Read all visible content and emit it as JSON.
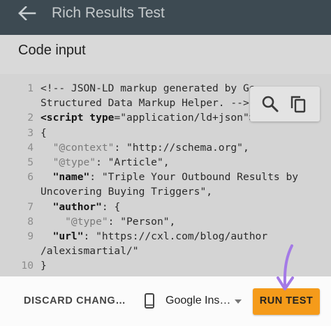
{
  "appbar": {
    "title": "Rich Results Test"
  },
  "panel": {
    "title": "Code input"
  },
  "code_lines": [
    {
      "num": "1",
      "tokens": [
        {
          "t": "<!-- JSON-LD markup generated by Go…",
          "c": "s-str"
        }
      ]
    },
    {
      "num": "",
      "tokens": [
        {
          "t": "Structured Data Markup Helper. -->",
          "c": "s-str"
        }
      ]
    },
    {
      "num": "2",
      "tokens": [
        {
          "t": "<script ",
          "c": "s-bold"
        },
        {
          "t": "type",
          "c": "s-bold"
        },
        {
          "t": "=\"application/ld+json\">",
          "c": "s-str"
        }
      ]
    },
    {
      "num": "3",
      "tokens": [
        {
          "t": "{",
          "c": "s-str"
        }
      ]
    },
    {
      "num": "4",
      "tokens": [
        {
          "t": "  \"@context\"",
          "c": "s-key"
        },
        {
          "t": ": \"http://schema.org\",",
          "c": "s-str"
        }
      ]
    },
    {
      "num": "5",
      "tokens": [
        {
          "t": "  \"@type\"",
          "c": "s-key"
        },
        {
          "t": ": \"Article\",",
          "c": "s-str"
        }
      ]
    },
    {
      "num": "6",
      "tokens": [
        {
          "t": "  \"name\"",
          "c": "s-bold"
        },
        {
          "t": ": \"Triple Your Outbound Results by",
          "c": "s-str"
        }
      ]
    },
    {
      "num": "",
      "tokens": [
        {
          "t": "Uncovering Buying Triggers\",",
          "c": "s-str"
        }
      ]
    },
    {
      "num": "7",
      "tokens": [
        {
          "t": "  \"author\"",
          "c": "s-bold"
        },
        {
          "t": ": {",
          "c": "s-str"
        }
      ]
    },
    {
      "num": "8",
      "tokens": [
        {
          "t": "    \"@type\"",
          "c": "s-key"
        },
        {
          "t": ": \"Person\",",
          "c": "s-str"
        }
      ]
    },
    {
      "num": "9",
      "tokens": [
        {
          "t": "  \"url\"",
          "c": "s-bold"
        },
        {
          "t": ": \"https://cxl.com/blog/author",
          "c": "s-str"
        }
      ]
    },
    {
      "num": "",
      "tokens": [
        {
          "t": "/alexismartial/\"",
          "c": "s-str"
        }
      ]
    },
    {
      "num": "10",
      "tokens": [
        {
          "t": "}",
          "c": "s-str"
        }
      ]
    }
  ],
  "toolbar": {
    "search_icon": "search-icon",
    "copy_icon": "copy-icon"
  },
  "bottom": {
    "discard_label": "DISCARD CHANG…",
    "device_label": "Google Ins…",
    "device_icon": "smartphone-icon",
    "run_label": "RUN TEST"
  },
  "colors": {
    "appbar": "#3d4a52",
    "run_button": "#f59b1a",
    "annotation": "#a47ae6"
  }
}
